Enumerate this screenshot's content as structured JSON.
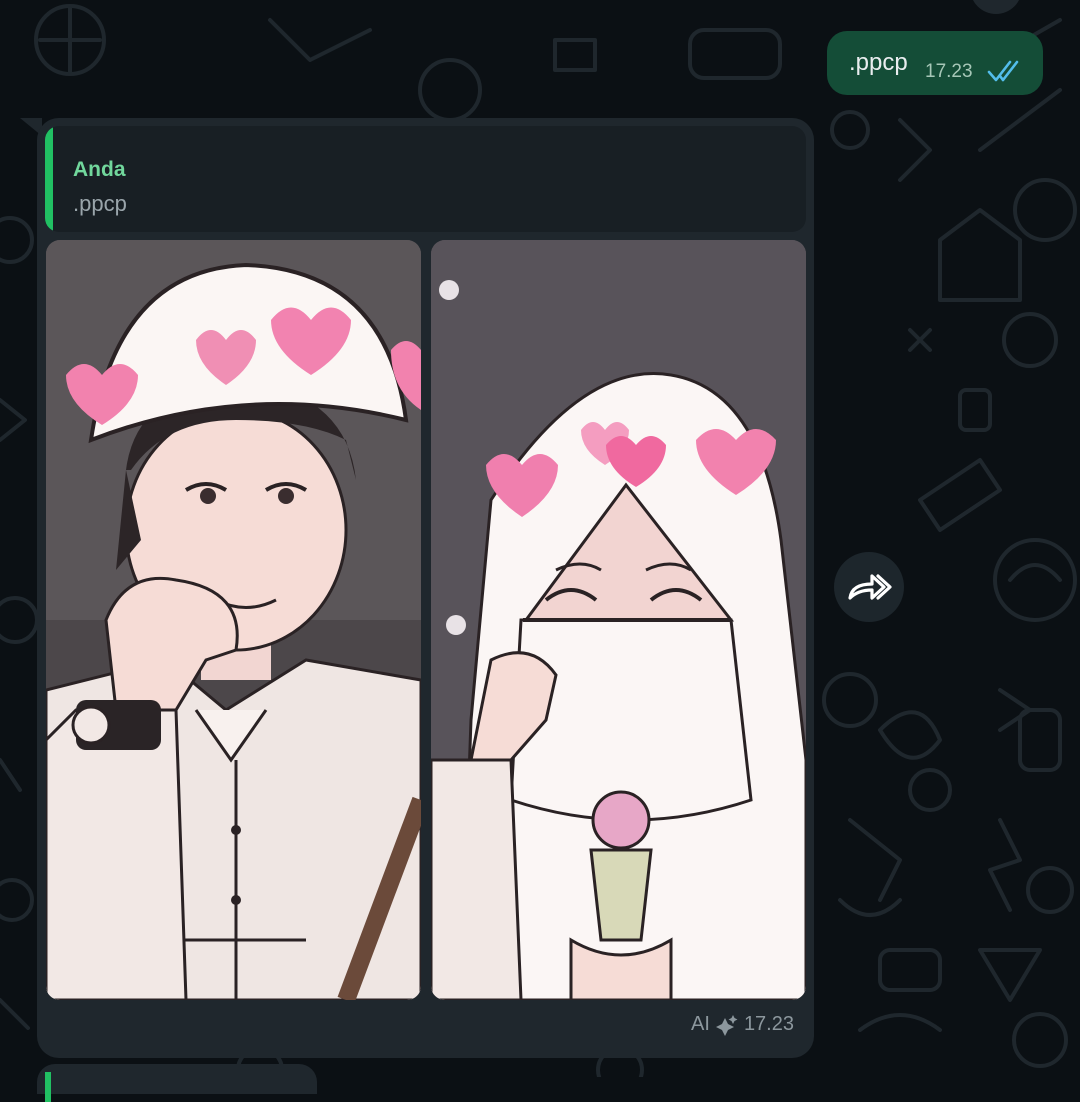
{
  "outgoing_message": {
    "text": ".ppcp",
    "time": "17.23",
    "status_icon": "double-check-read-icon"
  },
  "incoming_message": {
    "quoted": {
      "author": "Anda",
      "text": ".ppcp"
    },
    "images": [
      {
        "description_icon": "anime-boy-photo"
      },
      {
        "description_icon": "anime-girl-niqab-photo"
      }
    ],
    "ai_label": "AI",
    "time": "17.23"
  },
  "forward_button": {
    "icon": "forward-arrow-icon"
  },
  "colors": {
    "chat_background": "#0b1014",
    "outgoing_bubble": "#144d37",
    "incoming_bubble": "#1f272d",
    "quote_accent": "#21c063",
    "quote_author": "#71d79c",
    "read_ticks": "#53bdeb"
  }
}
